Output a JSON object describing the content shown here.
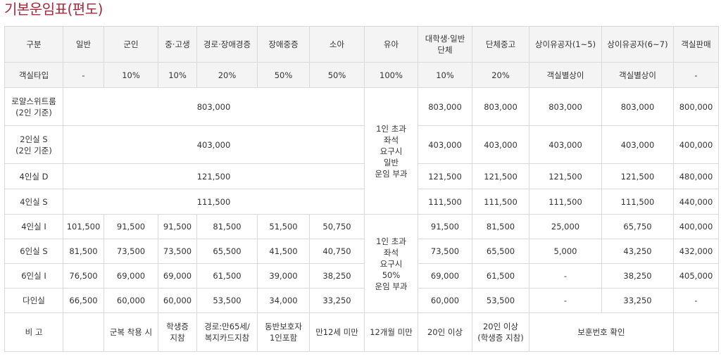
{
  "title": "기본운임표(편도)",
  "headers": [
    "구분",
    "일반",
    "군인",
    "중·고생",
    "경로·장애경증",
    "장애중증",
    "소아",
    "유아",
    "대학생·일반\n단체",
    "단체중고",
    "상이유공자(1~5)",
    "상이유공자(6~7)",
    "객실판매"
  ],
  "discount_row": {
    "label": "객실타입",
    "values": [
      "-",
      "10%",
      "10%",
      "20%",
      "50%",
      "50%",
      "100%",
      "10%",
      "20%",
      "객실별상이",
      "객실별상이",
      "-"
    ]
  },
  "merged_rows": [
    {
      "label": "로얄스위트룸\n(2인 기준)",
      "common": "803,000",
      "univ": "803,000",
      "group": "803,000",
      "vet15": "803,000",
      "vet67": "803,000",
      "room": "800,000"
    },
    {
      "label": "2인실 S\n(2인 기준)",
      "common": "403,000",
      "univ": "403,000",
      "group": "403,000",
      "vet15": "403,000",
      "vet67": "403,000",
      "room": "400,000"
    },
    {
      "label": "4인실 D",
      "common": "121,500",
      "univ": "121,500",
      "group": "121,500",
      "vet15": "121,500",
      "vet67": "121,500",
      "room": "480,000"
    },
    {
      "label": "4인실 S",
      "common": "111,500",
      "univ": "111,500",
      "group": "111,500",
      "vet15": "111,500",
      "vet67": "111,500",
      "room": "440,000"
    }
  ],
  "infant_note_1": "1인 초과\n좌석\n요구시\n일반\n운임 부과",
  "detail_rows": [
    {
      "label": "4인실 I",
      "values": [
        "101,500",
        "91,500",
        "91,500",
        "81,500",
        "51,500",
        "50,750"
      ],
      "univ": "91,500",
      "group": "81,500",
      "vet15": "25,000",
      "vet67": "65,750",
      "room": "400,000"
    },
    {
      "label": "6인실 S",
      "values": [
        "81,500",
        "73,500",
        "73,500",
        "65,500",
        "41,500",
        "40,750"
      ],
      "univ": "73,500",
      "group": "65,500",
      "vet15": "5,000",
      "vet67": "43,250",
      "room": "432,000"
    },
    {
      "label": "6인실 I",
      "values": [
        "76,500",
        "69,000",
        "69,000",
        "61,500",
        "39,000",
        "38,250"
      ],
      "univ": "69,000",
      "group": "61,500",
      "vet15": "-",
      "vet67": "38,250",
      "room": "405,000"
    },
    {
      "label": "다인실",
      "values": [
        "66,500",
        "60,000",
        "60,000",
        "53,500",
        "34,000",
        "33,250"
      ],
      "univ": "60,000",
      "group": "53,500",
      "vet15": "-",
      "vet67": "33,250",
      "room": "-"
    }
  ],
  "infant_note_2": "1인 초과\n좌석\n요구시\n50%\n운임 부과",
  "remarks": {
    "label": "비 고",
    "general": "",
    "soldier": "군복 착용 시",
    "student": "학생증\n지참",
    "senior": "경로:만65세/\n복지카드지참",
    "severe": "동반보호자\n1인포함",
    "child": "만12세 미만",
    "infant": "12개월 미만",
    "univ": "20인 이상",
    "group": "20인 이상\n(학생증 지참)",
    "veteran": "보훈번호 확인",
    "room": ""
  }
}
